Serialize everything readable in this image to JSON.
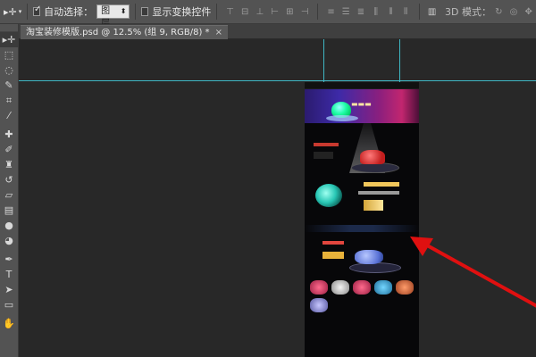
{
  "options_bar": {
    "auto_select_label": "自动选择：",
    "auto_select_checked": true,
    "layer_select_value": "图层",
    "show_transform_label": "显示变换控件",
    "show_transform_checked": false,
    "mode_3d_label": "3D 模式："
  },
  "document": {
    "tab_title": "淘宝装修模版.psd @ 12.5% (组 9, RGB/8) *",
    "close_glyph": "×"
  },
  "colors": {
    "guide": "#3fb7c4",
    "arrow": "#e01010"
  }
}
